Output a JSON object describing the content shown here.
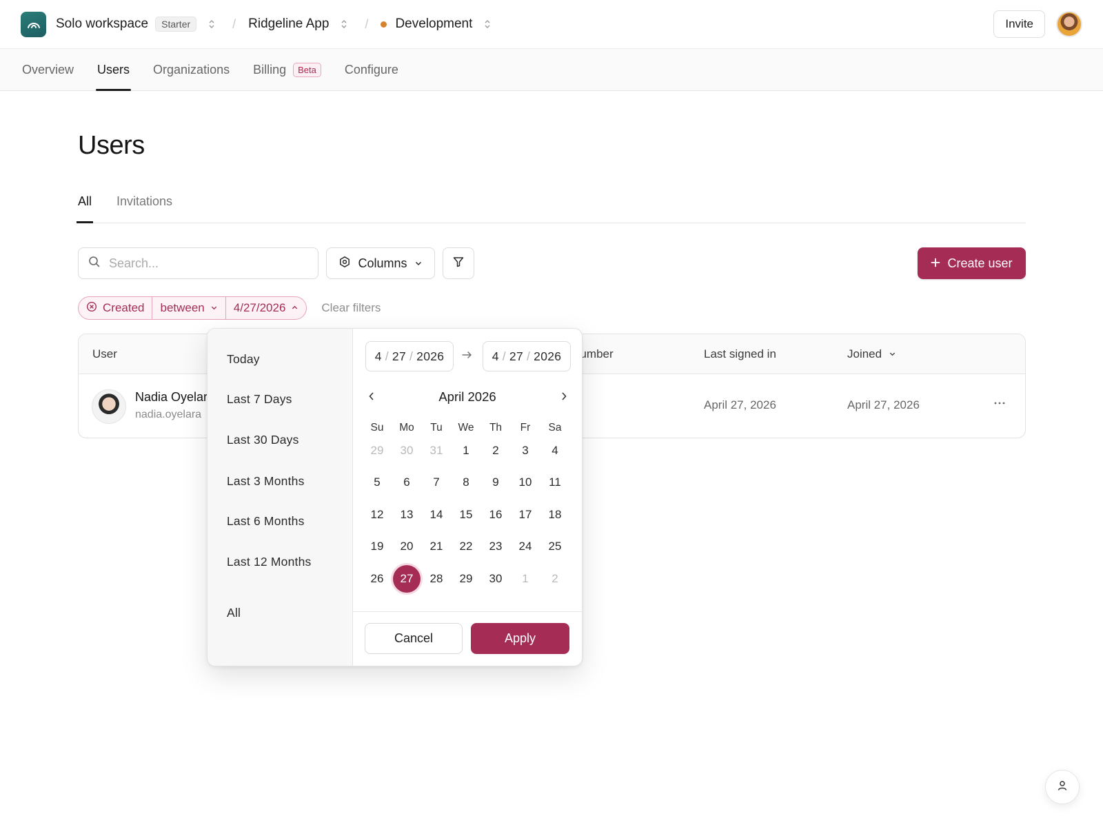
{
  "header": {
    "workspace_name": "Solo workspace",
    "plan_badge": "Starter",
    "app_name": "Ridgeline App",
    "environment": "Development",
    "environment_color": "#d6832f",
    "invite_label": "Invite",
    "logo_icon": "arch-logo-icon",
    "avatar_icon": "user-avatar"
  },
  "nav": {
    "tabs": [
      {
        "label": "Overview",
        "active": false
      },
      {
        "label": "Users",
        "active": true
      },
      {
        "label": "Organizations",
        "active": false
      },
      {
        "label": "Billing",
        "active": false,
        "badge": "Beta"
      },
      {
        "label": "Configure",
        "active": false
      }
    ]
  },
  "page": {
    "title": "Users",
    "subtabs": [
      {
        "label": "All",
        "active": true
      },
      {
        "label": "Invitations",
        "active": false
      }
    ]
  },
  "toolbar": {
    "search_placeholder": "Search...",
    "columns_label": "Columns",
    "create_user_label": "Create user"
  },
  "filters": {
    "field": "Created",
    "operator": "between",
    "value": "4/27/2026",
    "clear_label": "Clear filters"
  },
  "table": {
    "columns": {
      "user": "User",
      "phone_partial": "number",
      "last_signed_in": "Last signed in",
      "joined": "Joined"
    },
    "rows": [
      {
        "name": "Nadia Oyelar",
        "email": "nadia.oyelara",
        "last_signed_in": "April 27, 2026",
        "joined": "April 27, 2026"
      }
    ]
  },
  "datepicker": {
    "presets": [
      "Today",
      "Last 7 Days",
      "Last 30 Days",
      "Last 3 Months",
      "Last 6 Months",
      "Last 12 Months",
      "All"
    ],
    "start": {
      "month": "4",
      "day": "27",
      "year": "2026"
    },
    "end": {
      "month": "4",
      "day": "27",
      "year": "2026"
    },
    "month_title": "April 2026",
    "weekdays": [
      "Su",
      "Mo",
      "Tu",
      "We",
      "Th",
      "Fr",
      "Sa"
    ],
    "weeks": [
      [
        {
          "d": "29",
          "m": true
        },
        {
          "d": "30",
          "m": true
        },
        {
          "d": "31",
          "m": true
        },
        {
          "d": "1"
        },
        {
          "d": "2"
        },
        {
          "d": "3"
        },
        {
          "d": "4"
        }
      ],
      [
        {
          "d": "5"
        },
        {
          "d": "6"
        },
        {
          "d": "7"
        },
        {
          "d": "8"
        },
        {
          "d": "9"
        },
        {
          "d": "10"
        },
        {
          "d": "11"
        }
      ],
      [
        {
          "d": "12"
        },
        {
          "d": "13"
        },
        {
          "d": "14"
        },
        {
          "d": "15"
        },
        {
          "d": "16"
        },
        {
          "d": "17"
        },
        {
          "d": "18"
        }
      ],
      [
        {
          "d": "19"
        },
        {
          "d": "20"
        },
        {
          "d": "21"
        },
        {
          "d": "22"
        },
        {
          "d": "23"
        },
        {
          "d": "24"
        },
        {
          "d": "25"
        }
      ],
      [
        {
          "d": "26"
        },
        {
          "d": "27",
          "s": true
        },
        {
          "d": "28"
        },
        {
          "d": "29"
        },
        {
          "d": "30"
        },
        {
          "d": "1",
          "m": true
        },
        {
          "d": "2",
          "m": true
        }
      ]
    ],
    "selected_day": "27",
    "cancel_label": "Cancel",
    "apply_label": "Apply"
  },
  "colors": {
    "accent": "#a52d55",
    "accent_soft": "#fdf2f6",
    "logo": "#1d5d62"
  }
}
